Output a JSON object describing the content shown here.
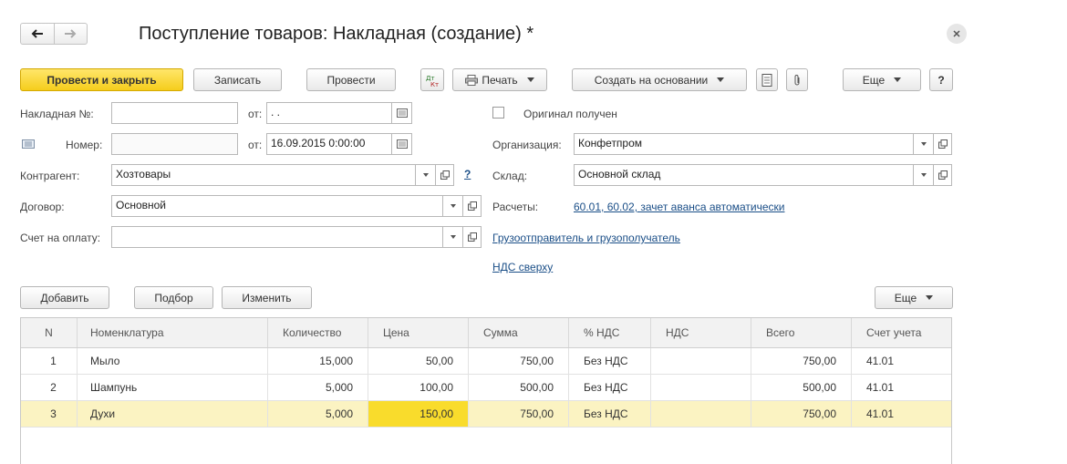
{
  "window": {
    "title": "Поступление товаров: Накладная (создание) *"
  },
  "toolbar": {
    "post_close": "Провести и закрыть",
    "save": "Записать",
    "post": "Провести",
    "print": "Печать",
    "create_based": "Создать на основании",
    "more": "Еще",
    "help": "?"
  },
  "form": {
    "invoice_no_label": "Накладная №:",
    "invoice_no_value": "",
    "from_label": "от:",
    "invoice_date_value": " .  .",
    "number_label": "Номер:",
    "number_value": "",
    "number_date_value": "16.09.2015  0:00:00",
    "original_label": "Оригинал получен",
    "org_label": "Организация:",
    "org_value": "Конфетпром",
    "contractor_label": "Контрагент:",
    "contractor_value": "Хозтовары",
    "help_mark": "?",
    "warehouse_label": "Склад:",
    "warehouse_value": "Основной склад",
    "contract_label": "Договор:",
    "contract_value": "Основной",
    "settlements_label": "Расчеты:",
    "settlements_link": "60.01, 60.02, зачет аванса автоматически",
    "payment_label": "Счет на оплату:",
    "payment_value": "",
    "shipper_link": "Грузоотправитель и грузополучатель",
    "vat_link": "НДС сверху"
  },
  "table_toolbar": {
    "add": "Добавить",
    "pick": "Подбор",
    "change": "Изменить",
    "more": "Еще"
  },
  "table": {
    "headers": [
      "N",
      "Номенклатура",
      "Количество",
      "Цена",
      "Сумма",
      "% НДС",
      "НДС",
      "Всего",
      "Счет учета"
    ],
    "rows": [
      [
        "1",
        "Мыло",
        "15,000",
        "50,00",
        "750,00",
        "Без НДС",
        "",
        "750,00",
        "41.01"
      ],
      [
        "2",
        "Шампунь",
        "5,000",
        "100,00",
        "500,00",
        "Без НДС",
        "",
        "500,00",
        "41.01"
      ],
      [
        "3",
        "Духи",
        "5,000",
        "150,00",
        "750,00",
        "Без НДС",
        "",
        "750,00",
        "41.01"
      ]
    ],
    "selected_row": 3
  },
  "colors": {
    "accent": "#f5cd1c",
    "selected_row": "#fbf3c2",
    "active_cell": "#f9dc2c",
    "link": "#1a4e87"
  }
}
